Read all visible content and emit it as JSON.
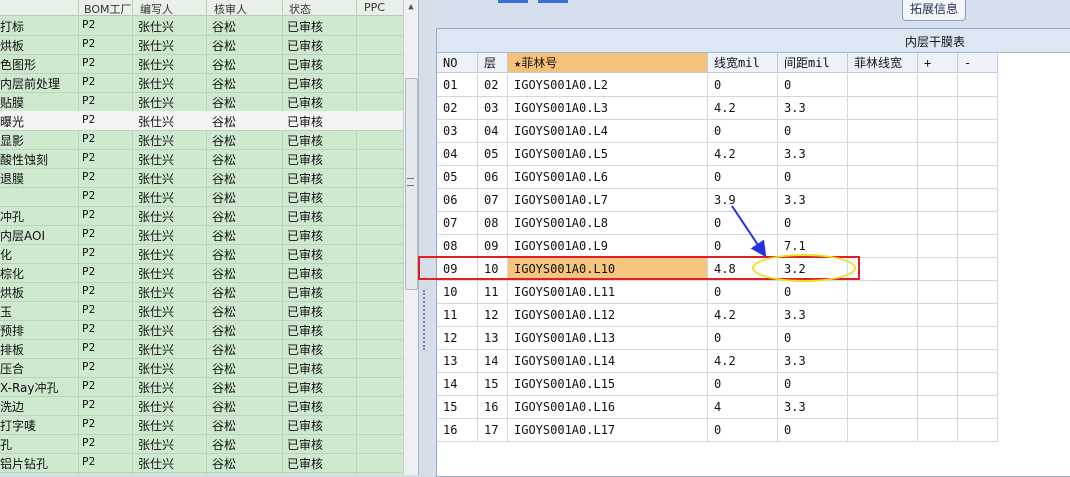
{
  "left_grid": {
    "headers": [
      "BOM工厂",
      "编写人",
      "核审人",
      "状态",
      "PPC"
    ],
    "selected_index": 5,
    "rows": [
      {
        "step": "打标",
        "bom": "P2",
        "author": "张仕兴",
        "reviewer": "谷松",
        "status": "已审核"
      },
      {
        "step": "烘板",
        "bom": "P2",
        "author": "张仕兴",
        "reviewer": "谷松",
        "status": "已审核"
      },
      {
        "step": "色图形",
        "bom": "P2",
        "author": "张仕兴",
        "reviewer": "谷松",
        "status": "已审核"
      },
      {
        "step": "内层前处理",
        "bom": "P2",
        "author": "张仕兴",
        "reviewer": "谷松",
        "status": "已审核"
      },
      {
        "step": "贴膜",
        "bom": "P2",
        "author": "张仕兴",
        "reviewer": "谷松",
        "status": "已审核"
      },
      {
        "step": "曝光",
        "bom": "P2",
        "author": "张仕兴",
        "reviewer": "谷松",
        "status": "已审核"
      },
      {
        "step": "显影",
        "bom": "P2",
        "author": "张仕兴",
        "reviewer": "谷松",
        "status": "已审核"
      },
      {
        "step": "酸性蚀刻",
        "bom": "P2",
        "author": "张仕兴",
        "reviewer": "谷松",
        "status": "已审核"
      },
      {
        "step": "退膜",
        "bom": "P2",
        "author": "张仕兴",
        "reviewer": "谷松",
        "status": "已审核"
      },
      {
        "step": "",
        "bom": "P2",
        "author": "张仕兴",
        "reviewer": "谷松",
        "status": "已审核"
      },
      {
        "step": "冲孔",
        "bom": "P2",
        "author": "张仕兴",
        "reviewer": "谷松",
        "status": "已审核"
      },
      {
        "step": "内层AOI",
        "bom": "P2",
        "author": "张仕兴",
        "reviewer": "谷松",
        "status": "已审核"
      },
      {
        "step": "化",
        "bom": "P2",
        "author": "张仕兴",
        "reviewer": "谷松",
        "status": "已审核"
      },
      {
        "step": "棕化",
        "bom": "P2",
        "author": "张仕兴",
        "reviewer": "谷松",
        "status": "已审核"
      },
      {
        "step": "烘板",
        "bom": "P2",
        "author": "张仕兴",
        "reviewer": "谷松",
        "status": "已审核"
      },
      {
        "step": "玉",
        "bom": "P2",
        "author": "张仕兴",
        "reviewer": "谷松",
        "status": "已审核"
      },
      {
        "step": "预排",
        "bom": "P2",
        "author": "张仕兴",
        "reviewer": "谷松",
        "status": "已审核"
      },
      {
        "step": "排板",
        "bom": "P2",
        "author": "张仕兴",
        "reviewer": "谷松",
        "status": "已审核"
      },
      {
        "step": "压合",
        "bom": "P2",
        "author": "张仕兴",
        "reviewer": "谷松",
        "status": "已审核"
      },
      {
        "step": "X-Ray冲孔",
        "bom": "P2",
        "author": "张仕兴",
        "reviewer": "谷松",
        "status": "已审核"
      },
      {
        "step": "洗边",
        "bom": "P2",
        "author": "张仕兴",
        "reviewer": "谷松",
        "status": "已审核"
      },
      {
        "step": "打字唛",
        "bom": "P2",
        "author": "张仕兴",
        "reviewer": "谷松",
        "status": "已审核"
      },
      {
        "step": "孔",
        "bom": "P2",
        "author": "张仕兴",
        "reviewer": "谷松",
        "status": "已审核"
      },
      {
        "step": "铝片钻孔",
        "bom": "P2",
        "author": "张仕兴",
        "reviewer": "谷松",
        "status": "已审核"
      }
    ]
  },
  "right_panel": {
    "tab_label": "拓展信息",
    "table_title": "内层干膜表",
    "columns": [
      "NO",
      "层",
      "★菲林号",
      "线宽mil",
      "间距mil",
      "菲林线宽",
      "+",
      "-"
    ],
    "selected_index": 8,
    "rows": [
      {
        "no": "01",
        "layer": "02",
        "film": "IGOYS001A0.L2",
        "width": "0",
        "space": "0"
      },
      {
        "no": "02",
        "layer": "03",
        "film": "IGOYS001A0.L3",
        "width": "4.2",
        "space": "3.3"
      },
      {
        "no": "03",
        "layer": "04",
        "film": "IGOYS001A0.L4",
        "width": "0",
        "space": "0"
      },
      {
        "no": "04",
        "layer": "05",
        "film": "IGOYS001A0.L5",
        "width": "4.2",
        "space": "3.3"
      },
      {
        "no": "05",
        "layer": "06",
        "film": "IGOYS001A0.L6",
        "width": "0",
        "space": "0"
      },
      {
        "no": "06",
        "layer": "07",
        "film": "IGOYS001A0.L7",
        "width": "3.9",
        "space": "3.3"
      },
      {
        "no": "07",
        "layer": "08",
        "film": "IGOYS001A0.L8",
        "width": "0",
        "space": "0"
      },
      {
        "no": "08",
        "layer": "09",
        "film": "IGOYS001A0.L9",
        "width": "0",
        "space": "7.1"
      },
      {
        "no": "09",
        "layer": "10",
        "film": "IGOYS001A0.L10",
        "width": "4.8",
        "space": "3.2"
      },
      {
        "no": "10",
        "layer": "11",
        "film": "IGOYS001A0.L11",
        "width": "0",
        "space": "0"
      },
      {
        "no": "11",
        "layer": "12",
        "film": "IGOYS001A0.L12",
        "width": "4.2",
        "space": "3.3"
      },
      {
        "no": "12",
        "layer": "13",
        "film": "IGOYS001A0.L13",
        "width": "0",
        "space": "0"
      },
      {
        "no": "13",
        "layer": "14",
        "film": "IGOYS001A0.L14",
        "width": "4.2",
        "space": "3.3"
      },
      {
        "no": "14",
        "layer": "15",
        "film": "IGOYS001A0.L15",
        "width": "0",
        "space": "0"
      },
      {
        "no": "15",
        "layer": "16",
        "film": "IGOYS001A0.L16",
        "width": "4",
        "space": "3.3"
      },
      {
        "no": "16",
        "layer": "17",
        "film": "IGOYS001A0.L17",
        "width": "0",
        "space": "0"
      }
    ]
  },
  "colors": {
    "left_bg": "#cfe9cf",
    "highlight": "#f7c57e",
    "annotation_red": "#e02020",
    "annotation_yellow": "#e8e020",
    "annotation_arrow": "#2233dd"
  }
}
